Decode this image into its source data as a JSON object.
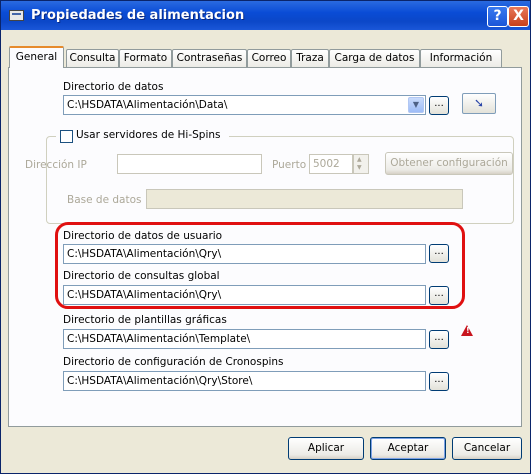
{
  "window": {
    "title": "Propiedades de alimentacion",
    "help_glyph": "?",
    "close_glyph": "X"
  },
  "tabs": [
    {
      "label": "General",
      "active": true
    },
    {
      "label": "Consulta"
    },
    {
      "label": "Formato"
    },
    {
      "label": "Contraseñas"
    },
    {
      "label": "Correo"
    },
    {
      "label": "Traza"
    },
    {
      "label": "Carga de datos"
    },
    {
      "label": "Información"
    }
  ],
  "data_dir": {
    "label": "Directorio de datos",
    "value": "C:\\HSDATA\\Alimentación\\Data\\",
    "browse": "...",
    "arrow_glyph": "➘"
  },
  "hispins": {
    "checkbox_label": "Usar servidores de Hi-Spins",
    "checked": false,
    "ip_label": "Dirección IP",
    "ip_value": "",
    "port_label": "Puerto",
    "port_value": "5002",
    "get_config_label": "Obtener configuración",
    "db_label": "Base de datos",
    "db_value": ""
  },
  "user_data_dir": {
    "label": "Directorio de datos de usuario",
    "value": "C:\\HSDATA\\Alimentación\\Qry\\",
    "browse": "..."
  },
  "global_query_dir": {
    "label": "Directorio de consultas global",
    "value": "C:\\HSDATA\\Alimentación\\Qry\\",
    "browse": "..."
  },
  "templates_dir": {
    "label": "Directorio de plantillas gráficas",
    "value": "C:\\HSDATA\\Alimentación\\Template\\",
    "browse": "..."
  },
  "cronospins_dir": {
    "label": "Directorio de configuración de Cronospins",
    "value": "C:\\HSDATA\\Alimentación\\Qry\\Store\\",
    "browse": "..."
  },
  "footer": {
    "apply": "Aplicar",
    "accept": "Aceptar",
    "cancel": "Cancelar"
  },
  "colors": {
    "titlebar": "#0A4CD6",
    "highlight": "#E01010",
    "warning": "#C8141E"
  }
}
